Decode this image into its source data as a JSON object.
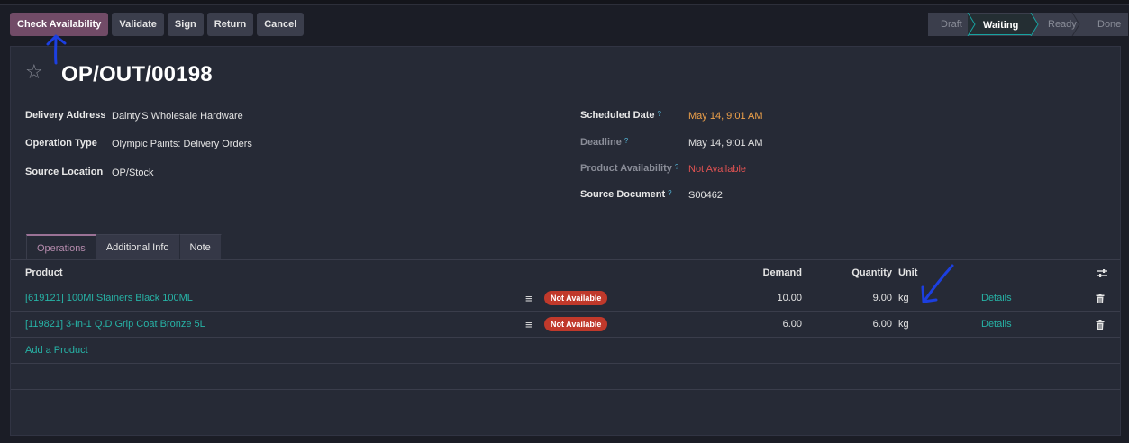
{
  "toolbar": {
    "check_availability": "Check Availability",
    "validate": "Validate",
    "sign": "Sign",
    "return": "Return",
    "cancel": "Cancel"
  },
  "statusbar": {
    "stages": [
      "Draft",
      "Waiting",
      "Ready",
      "Done"
    ],
    "current": "Waiting"
  },
  "record": {
    "title": "OP/OUT/00198",
    "left_fields": {
      "delivery_address_label": "Delivery Address",
      "delivery_address_value": "Dainty'S Wholesale Hardware",
      "operation_type_label": "Operation Type",
      "operation_type_value": "Olympic Paints: Delivery Orders",
      "source_location_label": "Source Location",
      "source_location_value": "OP/Stock"
    },
    "right_fields": {
      "scheduled_date_label": "Scheduled Date",
      "scheduled_date_value": "May 14, 9:01 AM",
      "deadline_label": "Deadline",
      "deadline_value": "May 14, 9:01 AM",
      "product_availability_label": "Product Availability",
      "product_availability_value": "Not Available",
      "source_document_label": "Source Document",
      "source_document_value": "S00462"
    }
  },
  "tabs": [
    "Operations",
    "Additional Info",
    "Note"
  ],
  "operations": {
    "headers": {
      "product": "Product",
      "demand": "Demand",
      "quantity": "Quantity",
      "unit": "Unit"
    },
    "rows": [
      {
        "product": "[619121] 100Ml Stainers Black 100ML",
        "status": "Not Available",
        "demand": "10.00",
        "quantity": "9.00",
        "unit": "kg",
        "details": "Details"
      },
      {
        "product": "[119821] 3-In-1 Q.D Grip Coat Bronze 5L",
        "status": "Not Available",
        "demand": "6.00",
        "quantity": "6.00",
        "unit": "kg",
        "details": "Details"
      }
    ],
    "add_product": "Add a Product"
  },
  "colors": {
    "primary": "#714b67",
    "link": "#27b3a6",
    "danger": "#c0392b",
    "warning": "#f0a24a",
    "annotation": "#1c3fe0"
  },
  "icons": {
    "star": "star-icon",
    "help": "help-icon",
    "drag": "hamburger-icon",
    "trash": "trash-icon",
    "settings": "sliders-icon"
  }
}
